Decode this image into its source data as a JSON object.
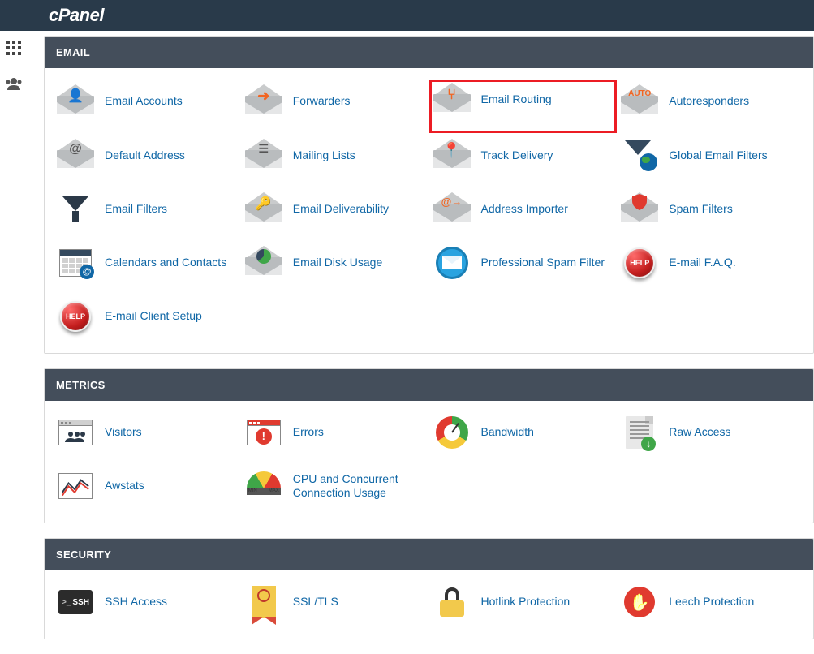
{
  "brand": "cPanel",
  "sections": [
    {
      "id": "email",
      "title": "EMAIL",
      "items": [
        {
          "label": "Email Accounts",
          "icon": "envelope-person",
          "highlight": false
        },
        {
          "label": "Forwarders",
          "icon": "envelope-arrow",
          "highlight": false
        },
        {
          "label": "Email Routing",
          "icon": "envelope-branch",
          "highlight": true
        },
        {
          "label": "Autoresponders",
          "icon": "envelope-auto",
          "highlight": false
        },
        {
          "label": "Default Address",
          "icon": "envelope-at",
          "highlight": false
        },
        {
          "label": "Mailing Lists",
          "icon": "envelope-list",
          "highlight": false
        },
        {
          "label": "Track Delivery",
          "icon": "envelope-pin",
          "highlight": false
        },
        {
          "label": "Global Email Filters",
          "icon": "globe-filter",
          "highlight": false
        },
        {
          "label": "Email Filters",
          "icon": "funnel",
          "highlight": false
        },
        {
          "label": "Email Deliverability",
          "icon": "envelope-key",
          "highlight": false
        },
        {
          "label": "Address Importer",
          "icon": "envelope-at-arrow",
          "highlight": false
        },
        {
          "label": "Spam Filters",
          "icon": "envelope-shield",
          "highlight": false
        },
        {
          "label": "Calendars and Contacts",
          "icon": "calendar",
          "highlight": false
        },
        {
          "label": "Email Disk Usage",
          "icon": "envelope-pie",
          "highlight": false
        },
        {
          "label": "Professional Spam Filter",
          "icon": "prof-spam",
          "highlight": false
        },
        {
          "label": "E-mail F.A.Q.",
          "icon": "help",
          "highlight": false
        },
        {
          "label": "E-mail Client Setup",
          "icon": "help",
          "highlight": false
        }
      ]
    },
    {
      "id": "metrics",
      "title": "METRICS",
      "items": [
        {
          "label": "Visitors",
          "icon": "visitors",
          "highlight": false
        },
        {
          "label": "Errors",
          "icon": "errors",
          "highlight": false
        },
        {
          "label": "Bandwidth",
          "icon": "bandwidth",
          "highlight": false
        },
        {
          "label": "Raw Access",
          "icon": "raw-access",
          "highlight": false
        },
        {
          "label": "Awstats",
          "icon": "awstats",
          "highlight": false
        },
        {
          "label": "CPU and Concurrent Connection Usage",
          "icon": "cpu-usage",
          "highlight": false
        }
      ]
    },
    {
      "id": "security",
      "title": "SECURITY",
      "items": [
        {
          "label": "SSH Access",
          "icon": "ssh",
          "highlight": false
        },
        {
          "label": "SSL/TLS",
          "icon": "ssl",
          "highlight": false
        },
        {
          "label": "Hotlink Protection",
          "icon": "hotlink",
          "highlight": false
        },
        {
          "label": "Leech Protection",
          "icon": "leech",
          "highlight": false
        }
      ]
    }
  ]
}
